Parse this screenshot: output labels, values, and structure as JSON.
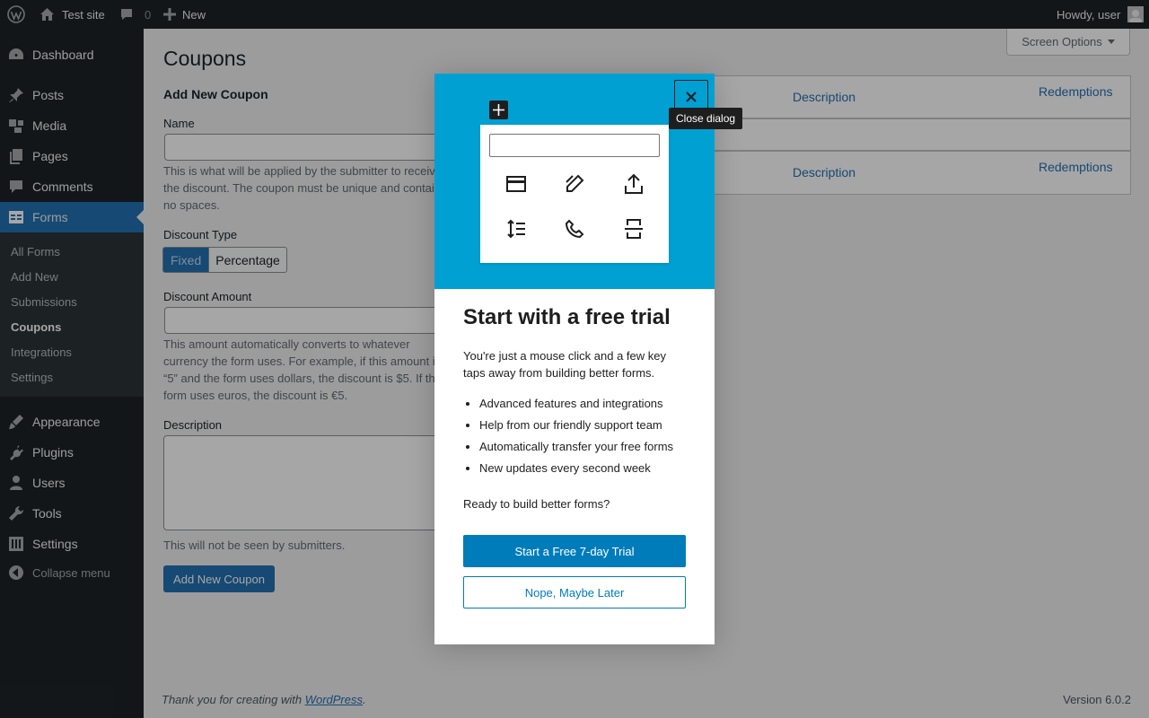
{
  "admin_bar": {
    "site_name": "Test site",
    "comment_count": "0",
    "new_label": "New",
    "howdy": "Howdy, user"
  },
  "sidebar": {
    "items": [
      {
        "label": "Dashboard",
        "icon": "dashboard-icon"
      },
      {
        "label": "Posts",
        "icon": "pin-icon"
      },
      {
        "label": "Media",
        "icon": "media-icon"
      },
      {
        "label": "Pages",
        "icon": "pages-icon"
      },
      {
        "label": "Comments",
        "icon": "comments-icon"
      },
      {
        "label": "Forms",
        "icon": "forms-icon"
      },
      {
        "label": "Appearance",
        "icon": "brush-icon"
      },
      {
        "label": "Plugins",
        "icon": "plugin-icon"
      },
      {
        "label": "Users",
        "icon": "user-icon"
      },
      {
        "label": "Tools",
        "icon": "wrench-icon"
      },
      {
        "label": "Settings",
        "icon": "settings-icon"
      }
    ],
    "submenu": [
      "All Forms",
      "Add New",
      "Submissions",
      "Coupons",
      "Integrations",
      "Settings"
    ],
    "collapse_label": "Collapse menu"
  },
  "main": {
    "screen_options": "Screen Options",
    "page_title": "Coupons",
    "form_title": "Add New Coupon",
    "name_label": "Name",
    "name_help": "This is what will be applied by the submitter to receive the discount. The coupon must be unique and contain no spaces.",
    "discount_type_label": "Discount Type",
    "discount_types": [
      "Fixed",
      "Percentage"
    ],
    "discount_amount_label": "Discount Amount",
    "discount_help": "This amount automatically converts to whatever currency the form uses. For example, if this amount is “5” and the form uses dollars, the discount is $5. If the form uses euros, the discount is €5.",
    "description_label": "Description",
    "description_help": "This will not be seen by submitters.",
    "add_button": "Add New Coupon",
    "table_headers": [
      "Description",
      "Redemptions"
    ],
    "footer_text": "Thank you for creating with ",
    "footer_link": "WordPress",
    "footer_end": ".",
    "version": "Version 6.0.2"
  },
  "modal": {
    "close_tooltip": "Close dialog",
    "heading": "Start with a free trial",
    "intro": "You're just a mouse click and a few key taps away from building better forms.",
    "features": [
      "Advanced features and integrations",
      "Help from our friendly support team",
      "Automatically transfer your free forms",
      "New updates every second week"
    ],
    "question": "Ready to build better forms?",
    "primary_button": "Start a Free 7-day Trial",
    "secondary_button": "Nope, Maybe Later",
    "hero_color": "#00a0d2",
    "block_icons": [
      "payment-block-icon",
      "signature-block-icon",
      "upload-block-icon",
      "number-line-block-icon",
      "phone-block-icon",
      "page-break-block-icon"
    ]
  }
}
